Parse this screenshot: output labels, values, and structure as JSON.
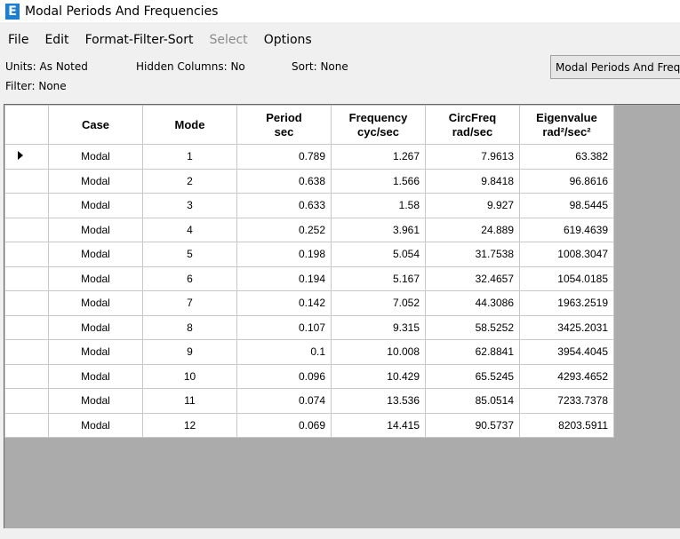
{
  "window": {
    "title": "Modal Periods And Frequencies",
    "app_icon_letter": "E"
  },
  "menu": {
    "file": "File",
    "edit": "Edit",
    "format": "Format-Filter-Sort",
    "select": "Select",
    "options": "Options"
  },
  "info": {
    "units": "Units: As Noted",
    "hidden": "Hidden Columns: No",
    "sort": "Sort: None",
    "filter": "Filter: None"
  },
  "table_selector": {
    "value": "Modal Periods And Frequencies"
  },
  "table": {
    "headers": [
      {
        "line1": "Case",
        "line2": ""
      },
      {
        "line1": "Mode",
        "line2": ""
      },
      {
        "line1": "Period",
        "line2": "sec"
      },
      {
        "line1": "Frequency",
        "line2": "cyc/sec"
      },
      {
        "line1": "CircFreq",
        "line2": "rad/sec"
      },
      {
        "line1": "Eigenvalue",
        "line2": "rad²/sec²"
      }
    ],
    "rows": [
      [
        "Modal",
        "1",
        "0.789",
        "1.267",
        "7.9613",
        "63.382"
      ],
      [
        "Modal",
        "2",
        "0.638",
        "1.566",
        "9.8418",
        "96.8616"
      ],
      [
        "Modal",
        "3",
        "0.633",
        "1.58",
        "9.927",
        "98.5445"
      ],
      [
        "Modal",
        "4",
        "0.252",
        "3.961",
        "24.889",
        "619.4639"
      ],
      [
        "Modal",
        "5",
        "0.198",
        "5.054",
        "31.7538",
        "1008.3047"
      ],
      [
        "Modal",
        "6",
        "0.194",
        "5.167",
        "32.4657",
        "1054.0185"
      ],
      [
        "Modal",
        "7",
        "0.142",
        "7.052",
        "44.3086",
        "1963.2519"
      ],
      [
        "Modal",
        "8",
        "0.107",
        "9.315",
        "58.5252",
        "3425.2031"
      ],
      [
        "Modal",
        "9",
        "0.1",
        "10.008",
        "62.8841",
        "3954.4045"
      ],
      [
        "Modal",
        "10",
        "0.096",
        "10.429",
        "65.5245",
        "4293.4652"
      ],
      [
        "Modal",
        "11",
        "0.074",
        "13.536",
        "85.0514",
        "7233.7378"
      ],
      [
        "Modal",
        "12",
        "0.069",
        "14.415",
        "90.5737",
        "8203.5911"
      ]
    ],
    "selected_row_index": 0
  }
}
